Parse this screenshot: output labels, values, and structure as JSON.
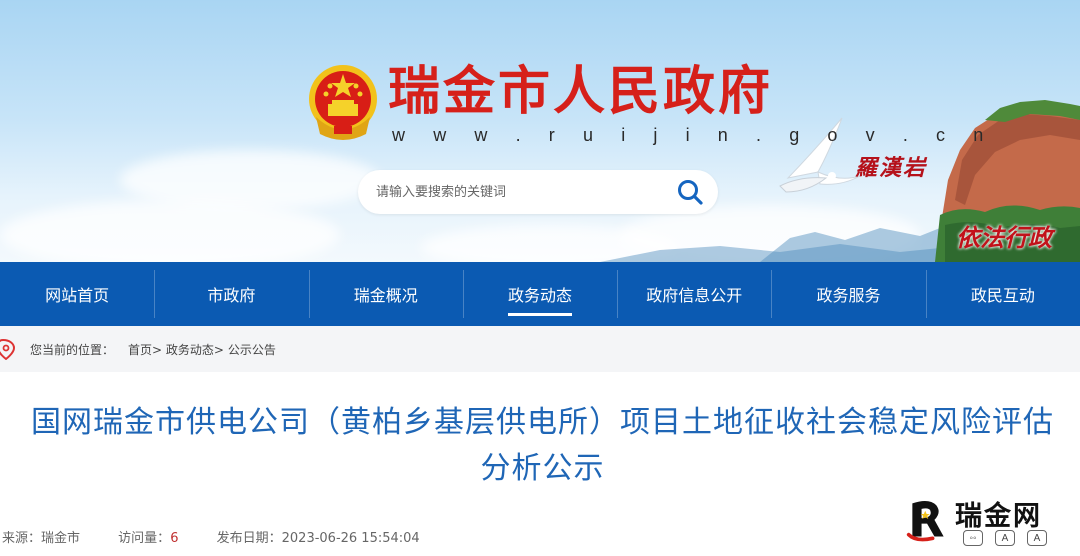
{
  "header": {
    "site_title": "瑞金市人民政府",
    "site_url": "w w w . r u i j i n . g o v . c n",
    "scenic_name": "羅漢岩",
    "slogan": "依法行政",
    "search": {
      "placeholder": "请输入要搜索的关键词"
    }
  },
  "nav": {
    "items": [
      {
        "label": "网站首页"
      },
      {
        "label": "市政府"
      },
      {
        "label": "瑞金概况"
      },
      {
        "label": "政务动态",
        "active": true
      },
      {
        "label": "政府信息公开"
      },
      {
        "label": "政务服务"
      },
      {
        "label": "政民互动"
      }
    ]
  },
  "breadcrumb": {
    "label": "您当前的位置：",
    "items": [
      "首页",
      "政务动态",
      "公示公告"
    ],
    "separator": ">"
  },
  "article": {
    "title": "国网瑞金市供电公司（黄柏乡基层供电所）项目土地征收社会稳定风险评估分析公示",
    "source_label": "来源：",
    "source_value": "瑞金市",
    "views_label": "访问量：",
    "views_value": "6",
    "date_label": "发布日期：",
    "date_value": "2023-06-26 15:54:04"
  },
  "watermark": {
    "text": "瑞金网",
    "icons": [
      "A",
      "A"
    ]
  },
  "colors": {
    "nav_bg": "#0b5ab2",
    "title_red": "#d6201a",
    "article_title_blue": "#1f66b6",
    "views_red": "#c03030"
  }
}
